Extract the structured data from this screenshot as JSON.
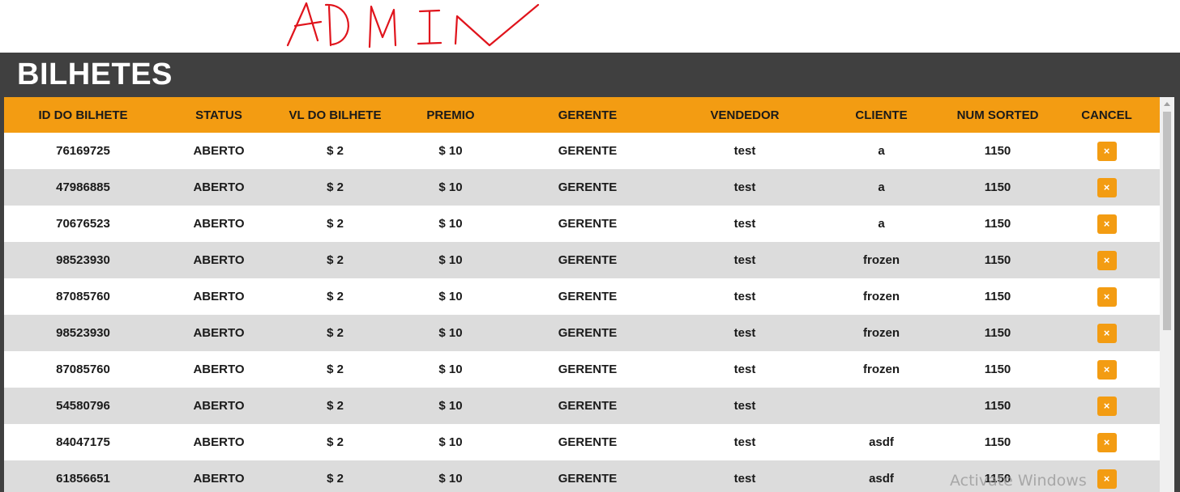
{
  "annotation": {
    "text": "ADMIN",
    "color": "#e0141c"
  },
  "panel": {
    "title": "BILHETES"
  },
  "colors": {
    "accent": "#f39c12",
    "header_bg": "#404040",
    "row_alt": "#dcdcdc"
  },
  "table": {
    "columns": [
      "ID DO BILHETE",
      "STATUS",
      "VL DO BILHETE",
      "PREMIO",
      "GERENTE",
      "VENDEDOR",
      "CLIENTE",
      "NUM SORTED",
      "CANCEL"
    ],
    "rows": [
      {
        "id": "76169725",
        "status": "ABERTO",
        "value": "$ 2",
        "prize": "$ 10",
        "manager": "GERENTE",
        "seller": "test",
        "client": "a",
        "num": "1150",
        "cancel": "×"
      },
      {
        "id": "47986885",
        "status": "ABERTO",
        "value": "$ 2",
        "prize": "$ 10",
        "manager": "GERENTE",
        "seller": "test",
        "client": "a",
        "num": "1150",
        "cancel": "×"
      },
      {
        "id": "70676523",
        "status": "ABERTO",
        "value": "$ 2",
        "prize": "$ 10",
        "manager": "GERENTE",
        "seller": "test",
        "client": "a",
        "num": "1150",
        "cancel": "×"
      },
      {
        "id": "98523930",
        "status": "ABERTO",
        "value": "$ 2",
        "prize": "$ 10",
        "manager": "GERENTE",
        "seller": "test",
        "client": "frozen",
        "num": "1150",
        "cancel": "×"
      },
      {
        "id": "87085760",
        "status": "ABERTO",
        "value": "$ 2",
        "prize": "$ 10",
        "manager": "GERENTE",
        "seller": "test",
        "client": "frozen",
        "num": "1150",
        "cancel": "×"
      },
      {
        "id": "98523930",
        "status": "ABERTO",
        "value": "$ 2",
        "prize": "$ 10",
        "manager": "GERENTE",
        "seller": "test",
        "client": "frozen",
        "num": "1150",
        "cancel": "×"
      },
      {
        "id": "87085760",
        "status": "ABERTO",
        "value": "$ 2",
        "prize": "$ 10",
        "manager": "GERENTE",
        "seller": "test",
        "client": "frozen",
        "num": "1150",
        "cancel": "×"
      },
      {
        "id": "54580796",
        "status": "ABERTO",
        "value": "$ 2",
        "prize": "$ 10",
        "manager": "GERENTE",
        "seller": "test",
        "client": "",
        "num": "1150",
        "cancel": "×"
      },
      {
        "id": "84047175",
        "status": "ABERTO",
        "value": "$ 2",
        "prize": "$ 10",
        "manager": "GERENTE",
        "seller": "test",
        "client": "asdf",
        "num": "1150",
        "cancel": "×"
      },
      {
        "id": "61856651",
        "status": "ABERTO",
        "value": "$ 2",
        "prize": "$ 10",
        "manager": "GERENTE",
        "seller": "test",
        "client": "asdf",
        "num": "1150",
        "cancel": "×"
      }
    ]
  },
  "watermark": {
    "text": "Activate Windows"
  }
}
